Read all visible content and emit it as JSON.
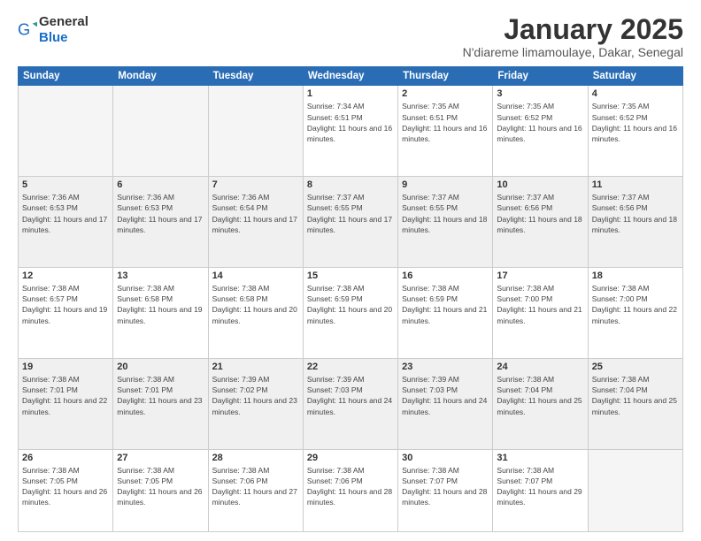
{
  "logo": {
    "general": "General",
    "blue": "Blue"
  },
  "header": {
    "month": "January 2025",
    "location": "N'diareme limamoulaye, Dakar, Senegal"
  },
  "days_of_week": [
    "Sunday",
    "Monday",
    "Tuesday",
    "Wednesday",
    "Thursday",
    "Friday",
    "Saturday"
  ],
  "weeks": [
    [
      {
        "day": "",
        "info": ""
      },
      {
        "day": "",
        "info": ""
      },
      {
        "day": "",
        "info": ""
      },
      {
        "day": "1",
        "info": "Sunrise: 7:34 AM\nSunset: 6:51 PM\nDaylight: 11 hours and 16 minutes."
      },
      {
        "day": "2",
        "info": "Sunrise: 7:35 AM\nSunset: 6:51 PM\nDaylight: 11 hours and 16 minutes."
      },
      {
        "day": "3",
        "info": "Sunrise: 7:35 AM\nSunset: 6:52 PM\nDaylight: 11 hours and 16 minutes."
      },
      {
        "day": "4",
        "info": "Sunrise: 7:35 AM\nSunset: 6:52 PM\nDaylight: 11 hours and 16 minutes."
      }
    ],
    [
      {
        "day": "5",
        "info": "Sunrise: 7:36 AM\nSunset: 6:53 PM\nDaylight: 11 hours and 17 minutes."
      },
      {
        "day": "6",
        "info": "Sunrise: 7:36 AM\nSunset: 6:53 PM\nDaylight: 11 hours and 17 minutes."
      },
      {
        "day": "7",
        "info": "Sunrise: 7:36 AM\nSunset: 6:54 PM\nDaylight: 11 hours and 17 minutes."
      },
      {
        "day": "8",
        "info": "Sunrise: 7:37 AM\nSunset: 6:55 PM\nDaylight: 11 hours and 17 minutes."
      },
      {
        "day": "9",
        "info": "Sunrise: 7:37 AM\nSunset: 6:55 PM\nDaylight: 11 hours and 18 minutes."
      },
      {
        "day": "10",
        "info": "Sunrise: 7:37 AM\nSunset: 6:56 PM\nDaylight: 11 hours and 18 minutes."
      },
      {
        "day": "11",
        "info": "Sunrise: 7:37 AM\nSunset: 6:56 PM\nDaylight: 11 hours and 18 minutes."
      }
    ],
    [
      {
        "day": "12",
        "info": "Sunrise: 7:38 AM\nSunset: 6:57 PM\nDaylight: 11 hours and 19 minutes."
      },
      {
        "day": "13",
        "info": "Sunrise: 7:38 AM\nSunset: 6:58 PM\nDaylight: 11 hours and 19 minutes."
      },
      {
        "day": "14",
        "info": "Sunrise: 7:38 AM\nSunset: 6:58 PM\nDaylight: 11 hours and 20 minutes."
      },
      {
        "day": "15",
        "info": "Sunrise: 7:38 AM\nSunset: 6:59 PM\nDaylight: 11 hours and 20 minutes."
      },
      {
        "day": "16",
        "info": "Sunrise: 7:38 AM\nSunset: 6:59 PM\nDaylight: 11 hours and 21 minutes."
      },
      {
        "day": "17",
        "info": "Sunrise: 7:38 AM\nSunset: 7:00 PM\nDaylight: 11 hours and 21 minutes."
      },
      {
        "day": "18",
        "info": "Sunrise: 7:38 AM\nSunset: 7:00 PM\nDaylight: 11 hours and 22 minutes."
      }
    ],
    [
      {
        "day": "19",
        "info": "Sunrise: 7:38 AM\nSunset: 7:01 PM\nDaylight: 11 hours and 22 minutes."
      },
      {
        "day": "20",
        "info": "Sunrise: 7:38 AM\nSunset: 7:01 PM\nDaylight: 11 hours and 23 minutes."
      },
      {
        "day": "21",
        "info": "Sunrise: 7:39 AM\nSunset: 7:02 PM\nDaylight: 11 hours and 23 minutes."
      },
      {
        "day": "22",
        "info": "Sunrise: 7:39 AM\nSunset: 7:03 PM\nDaylight: 11 hours and 24 minutes."
      },
      {
        "day": "23",
        "info": "Sunrise: 7:39 AM\nSunset: 7:03 PM\nDaylight: 11 hours and 24 minutes."
      },
      {
        "day": "24",
        "info": "Sunrise: 7:38 AM\nSunset: 7:04 PM\nDaylight: 11 hours and 25 minutes."
      },
      {
        "day": "25",
        "info": "Sunrise: 7:38 AM\nSunset: 7:04 PM\nDaylight: 11 hours and 25 minutes."
      }
    ],
    [
      {
        "day": "26",
        "info": "Sunrise: 7:38 AM\nSunset: 7:05 PM\nDaylight: 11 hours and 26 minutes."
      },
      {
        "day": "27",
        "info": "Sunrise: 7:38 AM\nSunset: 7:05 PM\nDaylight: 11 hours and 26 minutes."
      },
      {
        "day": "28",
        "info": "Sunrise: 7:38 AM\nSunset: 7:06 PM\nDaylight: 11 hours and 27 minutes."
      },
      {
        "day": "29",
        "info": "Sunrise: 7:38 AM\nSunset: 7:06 PM\nDaylight: 11 hours and 28 minutes."
      },
      {
        "day": "30",
        "info": "Sunrise: 7:38 AM\nSunset: 7:07 PM\nDaylight: 11 hours and 28 minutes."
      },
      {
        "day": "31",
        "info": "Sunrise: 7:38 AM\nSunset: 7:07 PM\nDaylight: 11 hours and 29 minutes."
      },
      {
        "day": "",
        "info": ""
      }
    ]
  ]
}
